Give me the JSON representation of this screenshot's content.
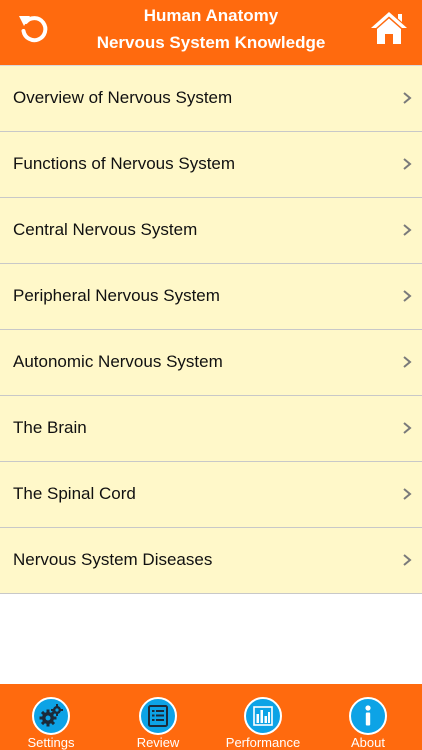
{
  "header": {
    "title_line1": "Human Anatomy",
    "title_line2": "Nervous System Knowledge",
    "left_icon": "refresh-icon",
    "right_icon": "home-icon"
  },
  "list": {
    "items": [
      {
        "label": "Overview of Nervous System"
      },
      {
        "label": "Functions of Nervous System"
      },
      {
        "label": "Central Nervous System"
      },
      {
        "label": "Peripheral Nervous System"
      },
      {
        "label": "Autonomic Nervous System"
      },
      {
        "label": "The Brain"
      },
      {
        "label": "The Spinal Cord"
      },
      {
        "label": "Nervous System Diseases"
      }
    ]
  },
  "tabbar": {
    "tabs": [
      {
        "label": "Settings",
        "icon": "gears-icon"
      },
      {
        "label": "Review",
        "icon": "list-icon"
      },
      {
        "label": "Performance",
        "icon": "bar-chart-icon"
      },
      {
        "label": "About",
        "icon": "info-icon"
      }
    ]
  },
  "colors": {
    "accent": "#ff6a0e",
    "row_background": "#fff8c9",
    "tab_icon": "#0da3e6",
    "divider": "#c8c8c8"
  }
}
